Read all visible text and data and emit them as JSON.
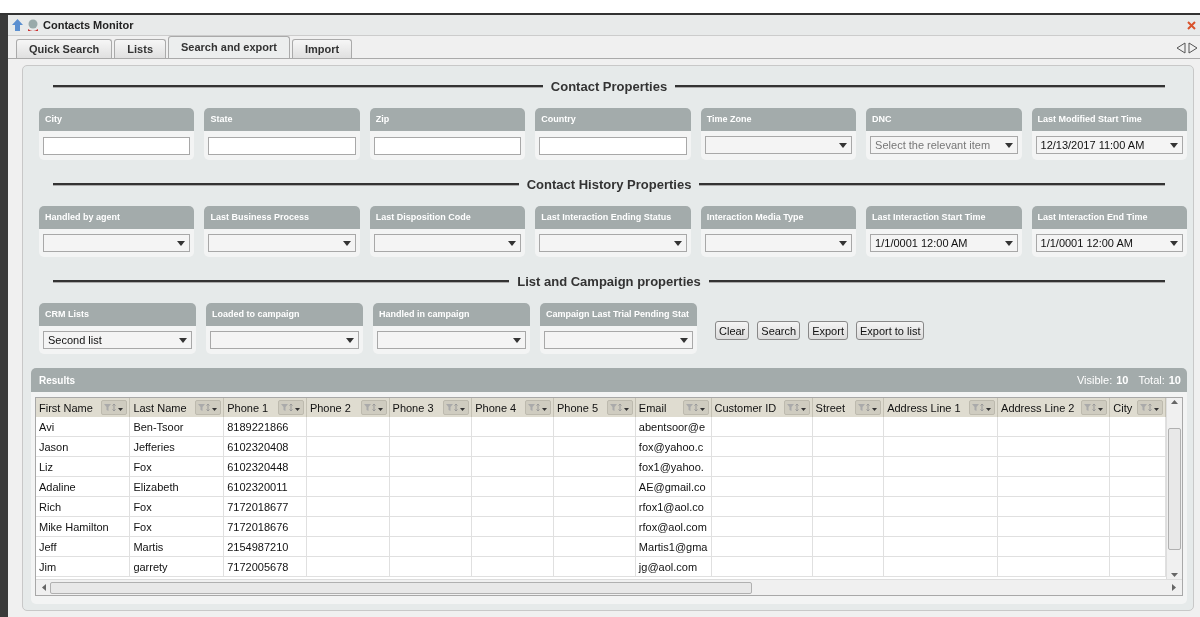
{
  "window": {
    "title": "Contacts Monitor"
  },
  "tabs": [
    {
      "label": "Quick Search",
      "selected": false
    },
    {
      "label": "Lists",
      "selected": false
    },
    {
      "label": "Search and export",
      "selected": true
    },
    {
      "label": "Import",
      "selected": false
    }
  ],
  "sections": [
    {
      "title": "Contact Properties",
      "fields": [
        {
          "label": "City",
          "kind": "text"
        },
        {
          "label": "State",
          "kind": "text"
        },
        {
          "label": "Zip",
          "kind": "text"
        },
        {
          "label": "Country",
          "kind": "text"
        },
        {
          "label": "Time Zone",
          "kind": "select"
        },
        {
          "label": "DNC",
          "kind": "select",
          "placeholder": "Select the relevant item"
        },
        {
          "label": "Last Modified Start Time",
          "kind": "select",
          "value": "12/13/2017 11:00 AM"
        }
      ]
    },
    {
      "title": "Contact History Properties",
      "fields": [
        {
          "label": "Handled by agent",
          "kind": "select"
        },
        {
          "label": "Last Business Process",
          "kind": "select"
        },
        {
          "label": "Last Disposition Code",
          "kind": "select"
        },
        {
          "label": "Last Interaction Ending Status",
          "kind": "select"
        },
        {
          "label": "Interaction Media Type",
          "kind": "select"
        },
        {
          "label": "Last Interaction Start Time",
          "kind": "select",
          "value": "1/1/0001 12:00 AM"
        },
        {
          "label": "Last Interaction End Time",
          "kind": "select",
          "value": "1/1/0001 12:00 AM"
        }
      ]
    },
    {
      "title": "List and Campaign properties",
      "fields": [
        {
          "label": "CRM Lists",
          "kind": "select",
          "value": "Second list"
        },
        {
          "label": "Loaded to campaign",
          "kind": "select"
        },
        {
          "label": "Handled in campaign",
          "kind": "select"
        },
        {
          "label": "Campaign Last Trial Pending Stat",
          "kind": "select"
        }
      ]
    }
  ],
  "buttons": [
    "Clear",
    "Search",
    "Export",
    "Export to list"
  ],
  "results": {
    "title": "Results",
    "visible_label": "Visible:",
    "visible": "10",
    "total_label": "Total:",
    "total": "10",
    "columns": [
      "First Name",
      "Last Name",
      "Phone 1",
      "Phone 2",
      "Phone 3",
      "Phone 4",
      "Phone 5",
      "Email",
      "Customer ID",
      "Street",
      "Address Line 1",
      "Address Line 2",
      "City"
    ],
    "rows": [
      [
        "Avi",
        "Ben-Tsoor",
        "8189221866",
        null,
        null,
        null,
        null,
        "abentsoor@e",
        null,
        null,
        null,
        null,
        null
      ],
      [
        "Jason",
        "Jefferies",
        "6102320408",
        null,
        null,
        null,
        null,
        "fox@yahoo.c",
        null,
        null,
        null,
        null,
        null
      ],
      [
        "Liz",
        "Fox",
        "6102320448",
        null,
        null,
        null,
        null,
        "fox1@yahoo.",
        null,
        null,
        null,
        null,
        null
      ],
      [
        "Adaline",
        "Elizabeth",
        "6102320011",
        null,
        null,
        null,
        null,
        "AE@gmail.co",
        null,
        null,
        null,
        null,
        null
      ],
      [
        "Rich",
        "Fox",
        "7172018677",
        null,
        null,
        null,
        null,
        "rfox1@aol.co",
        null,
        null,
        null,
        null,
        null
      ],
      [
        "Mike Hamilton",
        "Fox",
        "7172018676",
        null,
        null,
        null,
        null,
        "rfox@aol.com",
        null,
        null,
        null,
        null,
        null
      ],
      [
        "Jeff",
        "Martis",
        "2154987210",
        null,
        null,
        null,
        null,
        "Martis1@gma",
        null,
        null,
        null,
        null,
        null
      ],
      [
        "Jim",
        "garrety",
        "7172005678",
        null,
        null,
        null,
        null,
        "jg@aol.com",
        null,
        null,
        null,
        null,
        null
      ]
    ]
  }
}
